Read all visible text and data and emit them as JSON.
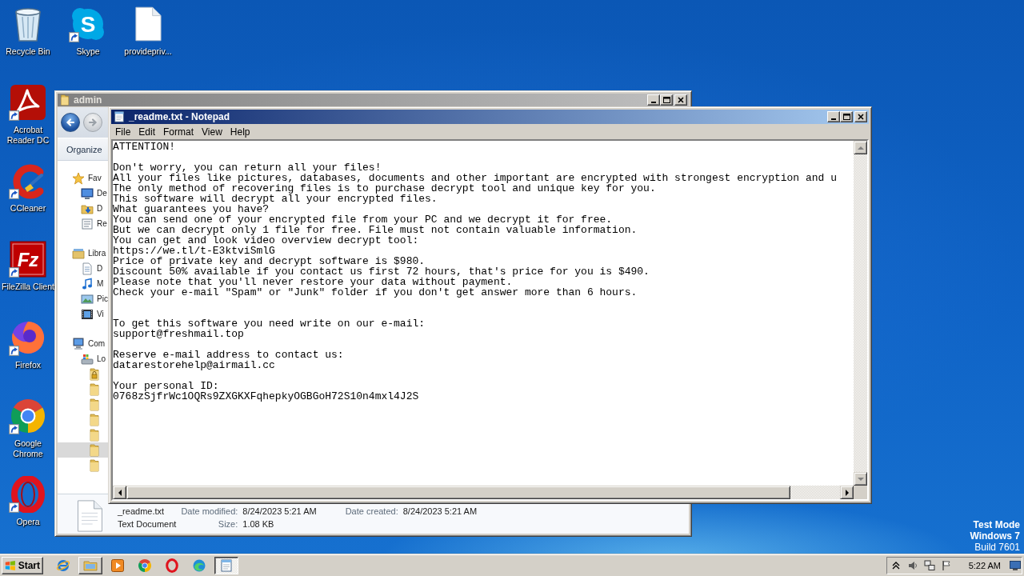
{
  "desktop": {
    "columns": [
      {
        "icons": [
          {
            "label": "Recycle Bin",
            "kind": "recycle-bin",
            "shortcut": false
          },
          {
            "label": "Acrobat Reader DC",
            "kind": "acrobat",
            "shortcut": true
          },
          {
            "label": "CCleaner",
            "kind": "ccleaner",
            "shortcut": true
          },
          {
            "label": "FileZilla Client",
            "kind": "filezilla",
            "logo_text": "Fz",
            "shortcut": true
          },
          {
            "label": "Firefox",
            "kind": "firefox",
            "shortcut": true
          },
          {
            "label": "Google Chrome",
            "kind": "chrome",
            "shortcut": true
          },
          {
            "label": "Opera",
            "kind": "opera",
            "shortcut": true
          }
        ]
      },
      {
        "icons": [
          {
            "label": "Skype",
            "kind": "skype",
            "logo_text": "S",
            "shortcut": true
          }
        ]
      },
      {
        "icons": [
          {
            "label": "providepriv...",
            "kind": "document",
            "shortcut": false
          }
        ]
      }
    ],
    "status_text": [
      {
        "text": "Test Mode",
        "emphasis": true
      },
      {
        "text": "Windows 7",
        "emphasis": true
      },
      {
        "text": "Build 7601",
        "emphasis": false
      }
    ]
  },
  "explorer": {
    "title": "admin",
    "active": false,
    "nav_buttons": [
      {
        "kind": "back",
        "disabled": false
      },
      {
        "kind": "forward",
        "disabled": true
      }
    ],
    "toolbar": [
      "Organize"
    ],
    "navigation_pane": {
      "items": [
        {
          "label": "Fav",
          "kind": "favorites",
          "selected": false,
          "children": [
            {
              "label": "De",
              "kind": "desktop",
              "selected": false
            },
            {
              "label": "D",
              "kind": "downloads",
              "selected": false
            },
            {
              "label": "Re",
              "kind": "recent",
              "selected": false
            }
          ]
        },
        {
          "label": "Libra",
          "kind": "libraries",
          "selected": false,
          "children": [
            {
              "label": "D",
              "kind": "documents",
              "selected": false
            },
            {
              "label": "M",
              "kind": "music",
              "selected": false
            },
            {
              "label": "Pic",
              "kind": "pictures",
              "selected": false
            },
            {
              "label": "Vi",
              "kind": "videos",
              "selected": false
            }
          ]
        },
        {
          "label": "Com",
          "kind": "computer",
          "selected": false,
          "children": [
            {
              "label": "Lo",
              "kind": "drive",
              "selected": false,
              "children": [
                {
                  "kind": "user-folder",
                  "selected": false
                },
                {
                  "kind": "folder",
                  "selected": false
                },
                {
                  "kind": "folder",
                  "selected": false
                },
                {
                  "kind": "folder",
                  "selected": false
                },
                {
                  "kind": "folder",
                  "selected": false
                },
                {
                  "kind": "folder",
                  "selected": true
                },
                {
                  "kind": "folder",
                  "selected": false
                }
              ]
            }
          ]
        }
      ]
    },
    "details_pane": {
      "name": "_readme.txt",
      "type": "Text Document",
      "properties": [
        {
          "label": "Date modified:",
          "value": "8/24/2023 5:21 AM"
        },
        {
          "label": "Size:",
          "value": "1.08 KB"
        },
        {
          "label": "Date created:",
          "value": "8/24/2023 5:21 AM"
        }
      ]
    }
  },
  "notepad": {
    "title": "_readme.txt - Notepad",
    "active": true,
    "menu": [
      "File",
      "Edit",
      "Format",
      "View",
      "Help"
    ],
    "lines": [
      {
        "kind": "text",
        "text": "ATTENTION!"
      },
      {
        "kind": "blank"
      },
      {
        "kind": "text",
        "text": "Don't worry, you can return all your files!"
      },
      {
        "kind": "text",
        "text": "All your files like pictures, databases, documents and other important are encrypted with strongest encryption and u"
      },
      {
        "kind": "text",
        "text": "The only method of recovering files is to purchase decrypt tool and unique key for you."
      },
      {
        "kind": "text",
        "text": "This software will decrypt all your encrypted files."
      },
      {
        "kind": "text",
        "text": "What guarantees you have?"
      },
      {
        "kind": "text",
        "text": "You can send one of your encrypted file from your PC and we decrypt it for free."
      },
      {
        "kind": "text",
        "text": "But we can decrypt only 1 file for free. File must not contain valuable information."
      },
      {
        "kind": "text",
        "text": "You can get and look video overview decrypt tool:"
      },
      {
        "kind": "text",
        "text": "https://we.tl/t-E3ktviSmlG"
      },
      {
        "kind": "text",
        "text": "Price of private key and decrypt software is $980."
      },
      {
        "kind": "text",
        "text": "Discount 50% available if you contact us first 72 hours, that's price for you is $490."
      },
      {
        "kind": "text",
        "text": "Please note that you'll never restore your data without payment."
      },
      {
        "kind": "text",
        "text": "Check your e-mail \"Spam\" or \"Junk\" folder if you don't get answer more than 6 hours."
      },
      {
        "kind": "blank"
      },
      {
        "kind": "blank"
      },
      {
        "kind": "text",
        "text": "To get this software you need write on our e-mail:"
      },
      {
        "kind": "text",
        "text": "support@freshmail.top"
      },
      {
        "kind": "blank"
      },
      {
        "kind": "text",
        "text": "Reserve e-mail address to contact us:"
      },
      {
        "kind": "text",
        "text": "datarestorehelp@airmail.cc"
      },
      {
        "kind": "blank"
      },
      {
        "kind": "text",
        "text": "Your personal ID:"
      },
      {
        "kind": "text",
        "text": "0768zSjfrWc1OQRs9ZXGKXFqhepkyOGBGoH72S10n4mxl4J2S"
      }
    ]
  },
  "taskbar": {
    "start_label": "Start",
    "items": [
      {
        "kind": "internet-explorer",
        "running": false,
        "selected": false
      },
      {
        "kind": "file-explorer",
        "running": true,
        "selected": false
      },
      {
        "kind": "media-player",
        "running": false,
        "selected": false
      },
      {
        "kind": "chrome",
        "running": false,
        "selected": false
      },
      {
        "kind": "opera",
        "running": false,
        "selected": false
      },
      {
        "kind": "edge",
        "running": false,
        "selected": false
      },
      {
        "kind": "notepad",
        "running": true,
        "selected": true
      }
    ],
    "clock": "5:22 AM"
  }
}
